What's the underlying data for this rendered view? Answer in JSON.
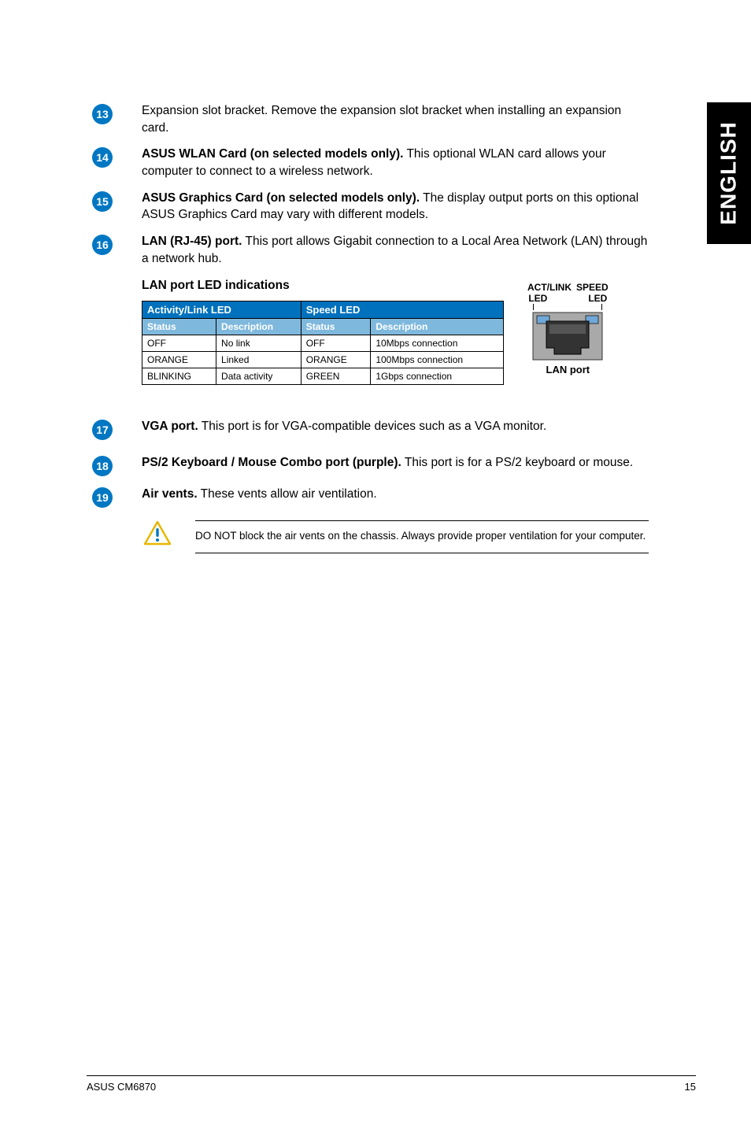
{
  "side_tab": "ENGLISH",
  "items": {
    "i13": {
      "num": "13",
      "text": "Expansion slot bracket. Remove the expansion slot bracket when installing an expansion card."
    },
    "i14": {
      "num": "14",
      "bold": "ASUS WLAN Card (on selected models only).",
      "rest": " This optional WLAN card allows your computer to connect to a wireless network."
    },
    "i15": {
      "num": "15",
      "bold": "ASUS Graphics Card (on selected models only).",
      "rest": " The display output ports on this optional ASUS Graphics Card may vary with different models."
    },
    "i16": {
      "num": "16",
      "bold": "LAN (RJ-45) port.",
      "rest": " This port allows Gigabit connection to a Local Area Network (LAN) through a network hub."
    },
    "i17": {
      "num": "17",
      "bold": "VGA port.",
      "rest": " This port is for VGA-compatible devices such as a VGA monitor."
    },
    "i18": {
      "num": "18",
      "bold": "PS/2 Keyboard / Mouse Combo port (purple).",
      "rest": " This port is for a PS/2 keyboard or mouse."
    },
    "i19": {
      "num": "19",
      "bold": "Air vents.",
      "rest": " These vents allow air ventilation."
    }
  },
  "led": {
    "heading": "LAN port LED indications",
    "col1": "Activity/Link LED",
    "col2": "Speed LED",
    "sub1": "Status",
    "sub2": "Description",
    "sub3": "Status",
    "sub4": "Description",
    "r1c1": "OFF",
    "r1c2": "No link",
    "r1c3": "OFF",
    "r1c4": "10Mbps connection",
    "r2c1": "ORANGE",
    "r2c2": "Linked",
    "r2c3": "ORANGE",
    "r2c4": "100Mbps connection",
    "r3c1": "BLINKING",
    "r3c2": "Data activity",
    "r3c3": "GREEN",
    "r3c4": "1Gbps connection"
  },
  "port": {
    "top1": "ACT/LINK",
    "top2": "SPEED",
    "bot1": "LED",
    "bot2": "LED",
    "caption": "LAN port"
  },
  "caution": "DO NOT block the air vents on the chassis. Always provide proper ventilation for your computer.",
  "footer": {
    "left": "ASUS CM6870",
    "right": "15"
  }
}
